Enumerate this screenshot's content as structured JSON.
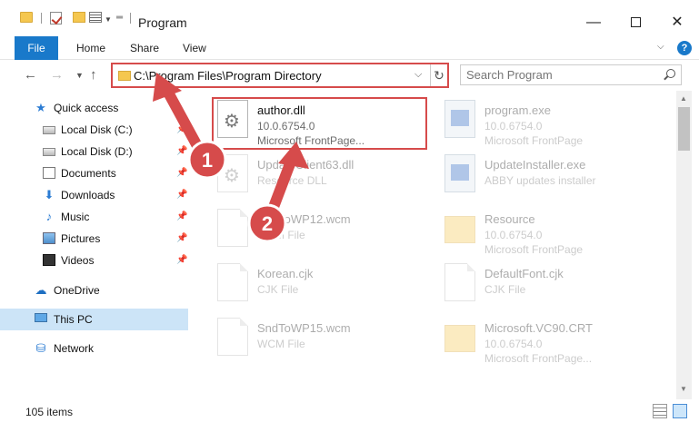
{
  "window": {
    "title": "Program",
    "minimize": "—",
    "close": "✕"
  },
  "ribbon": {
    "tabs": [
      "File",
      "Home",
      "Share",
      "View"
    ]
  },
  "address_bar": {
    "path": "C:\\Program Files\\Program Directory",
    "dropdown": "⌵",
    "refresh": "↻"
  },
  "search": {
    "placeholder": "Search Program"
  },
  "sidebar": {
    "items": [
      {
        "label": "Quick access",
        "icon": "star-icon",
        "pinned": false
      },
      {
        "label": "Local Disk (C:)",
        "icon": "drive-icon",
        "pinned": true
      },
      {
        "label": "Local Disk (D:)",
        "icon": "drive-icon",
        "pinned": true
      },
      {
        "label": "Documents",
        "icon": "documents-icon",
        "pinned": true
      },
      {
        "label": "Downloads",
        "icon": "downloads-icon",
        "pinned": true
      },
      {
        "label": "Music",
        "icon": "music-icon",
        "pinned": true
      },
      {
        "label": "Pictures",
        "icon": "pictures-icon",
        "pinned": true
      },
      {
        "label": "Videos",
        "icon": "videos-icon",
        "pinned": true
      },
      {
        "label": "OneDrive",
        "icon": "onedrive-icon",
        "pinned": false
      },
      {
        "label": "This PC",
        "icon": "this-pc-icon",
        "pinned": false,
        "selected": true
      },
      {
        "label": "Network",
        "icon": "network-icon",
        "pinned": false
      }
    ]
  },
  "files": [
    {
      "name": "author.dll",
      "line1": "10.0.6754.0",
      "line2": "Microsoft FrontPage...",
      "icon": "dll-gear-icon",
      "highlighted": true
    },
    {
      "name": "program.exe",
      "line1": "10.0.6754.0",
      "line2": "Microsoft FrontPage",
      "icon": "exe-icon"
    },
    {
      "name": "UpdateClient63.dll",
      "line1": "Resource DLL",
      "line2": "",
      "icon": "dll-gear-icon"
    },
    {
      "name": "UpdateInstaller.exe",
      "line1": "ABBY updates installer",
      "line2": "",
      "icon": "exe-icon"
    },
    {
      "name": "SndToWP12.wcm",
      "line1": "WCM File",
      "line2": "",
      "icon": "file-icon"
    },
    {
      "name": "Resource",
      "line1": "10.0.6754.0",
      "line2": "Microsoft FrontPage",
      "icon": "folder-icon"
    },
    {
      "name": "Korean.cjk",
      "line1": "CJK File",
      "line2": "",
      "icon": "file-icon"
    },
    {
      "name": "DefaultFont.cjk",
      "line1": "CJK File",
      "line2": "",
      "icon": "file-icon"
    },
    {
      "name": "SndToWP15.wcm",
      "line1": "WCM File",
      "line2": "",
      "icon": "file-icon"
    },
    {
      "name": "Microsoft.VC90.CRT",
      "line1": "10.0.6754.0",
      "line2": "Microsoft FrontPage...",
      "icon": "folder-icon"
    }
  ],
  "callouts": [
    "1",
    "2"
  ],
  "status": {
    "item_count": "105 items"
  },
  "colors": {
    "accent": "#1979ca",
    "highlight_box": "#d64b4b",
    "selection": "#cce4f7"
  }
}
